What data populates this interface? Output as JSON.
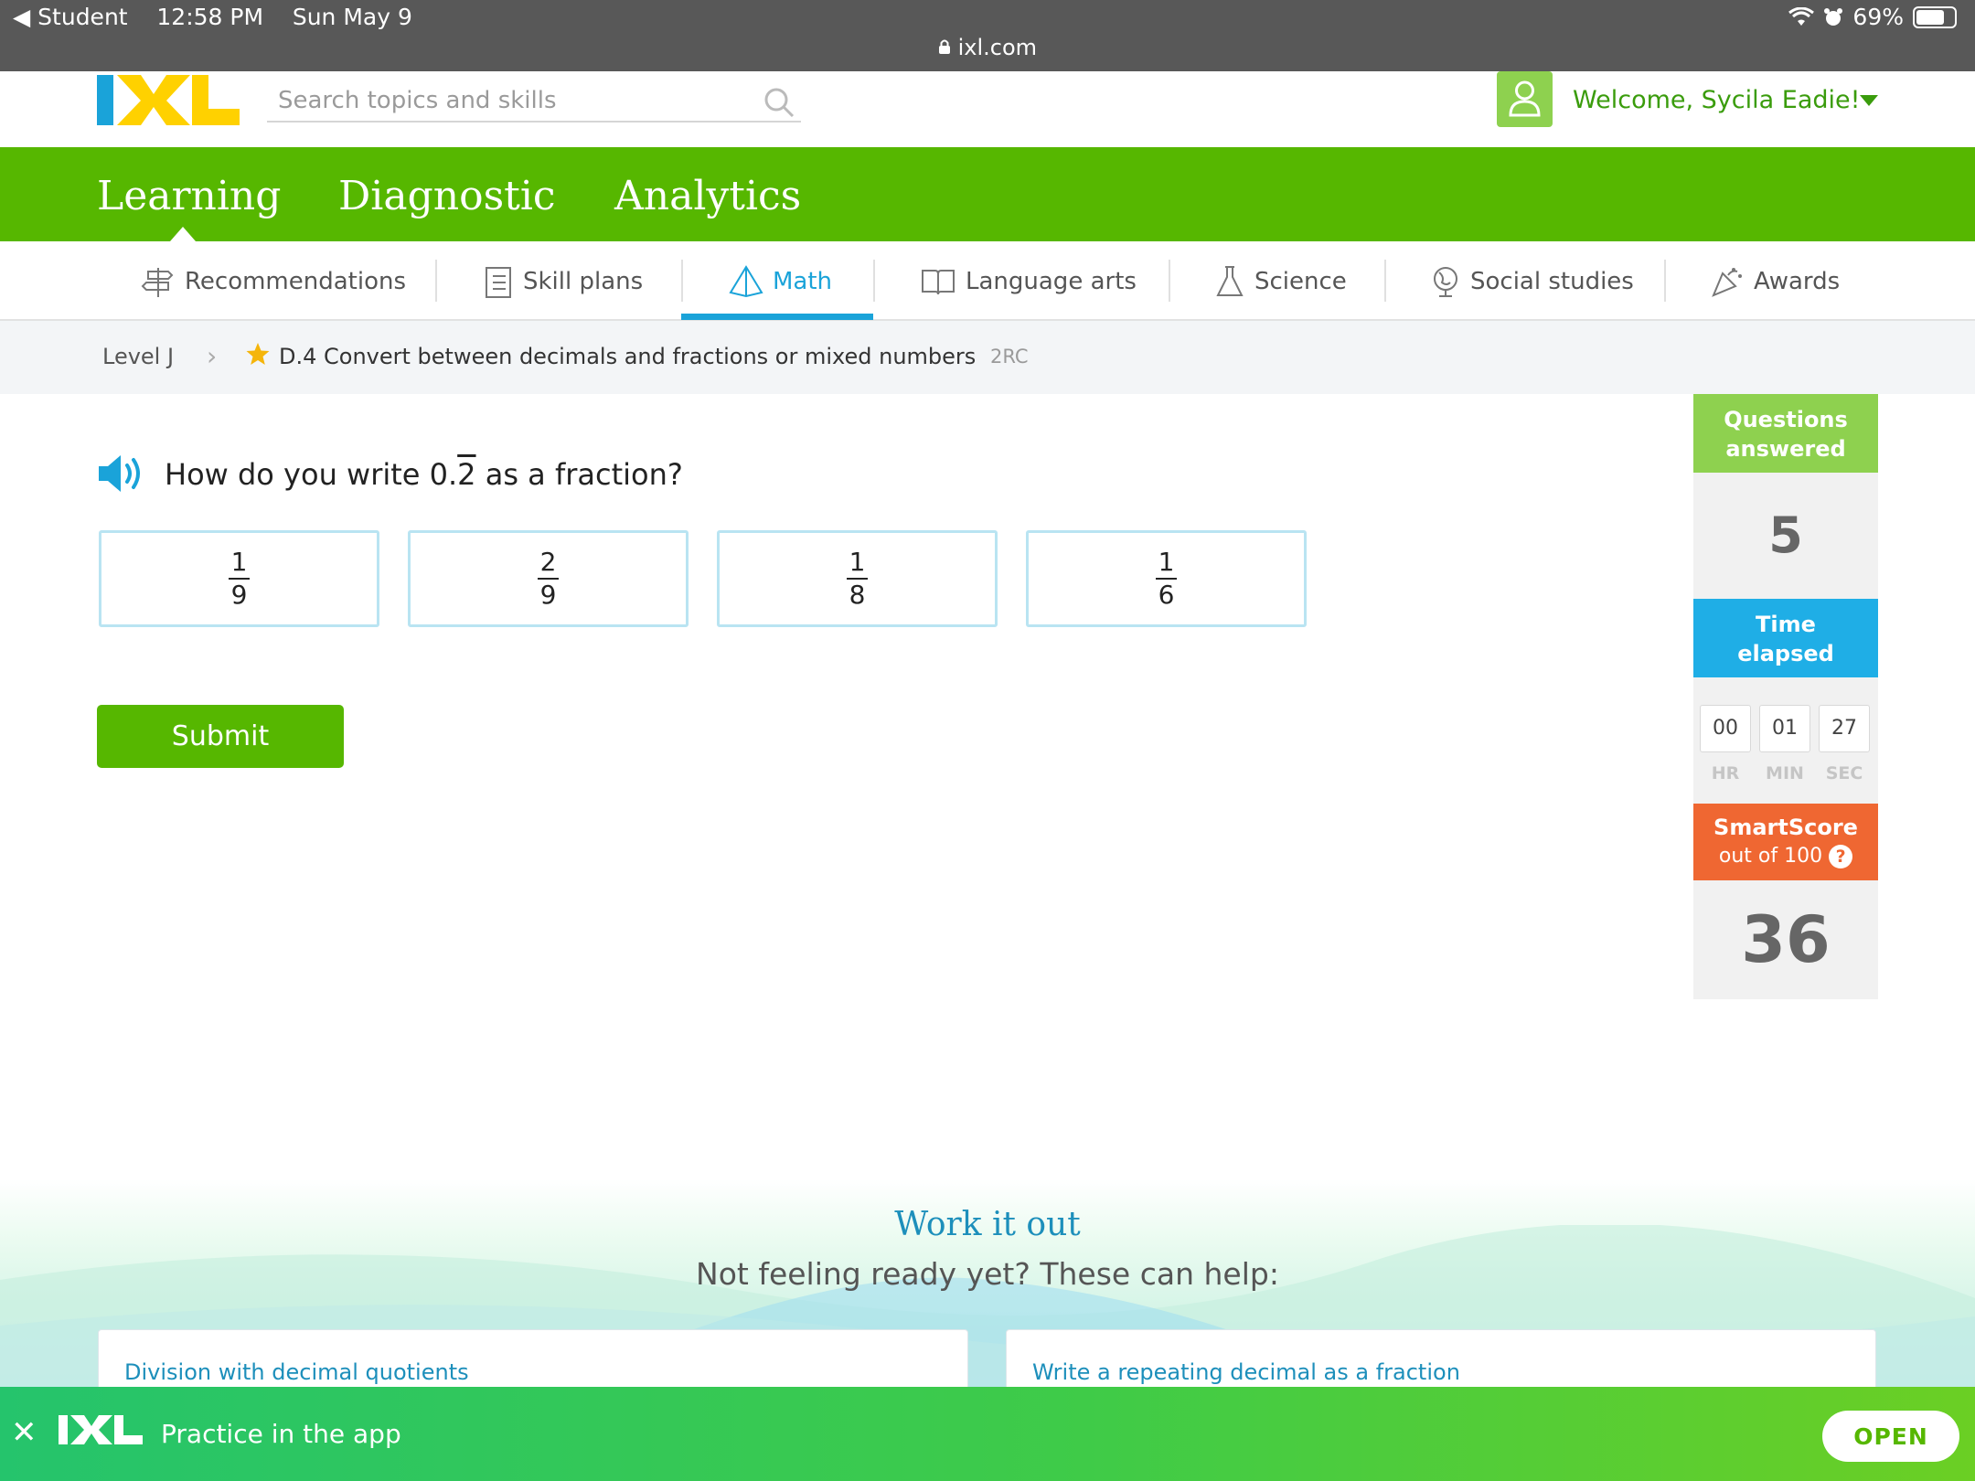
{
  "status_bar": {
    "back_app": "◀ Student",
    "time": "12:58 PM",
    "date": "Sun May 9",
    "battery": "69%",
    "url": "ixl.com"
  },
  "header": {
    "search_placeholder": "Search topics and skills",
    "welcome": "Welcome, Sycila Eadie!"
  },
  "main_nav": {
    "tabs": [
      {
        "label": "Learning",
        "active": true
      },
      {
        "label": "Diagnostic"
      },
      {
        "label": "Analytics"
      }
    ]
  },
  "subject_nav": {
    "tabs": [
      {
        "label": "Recommendations",
        "icon": "signpost-icon"
      },
      {
        "label": "Skill plans",
        "icon": "checklist-icon"
      },
      {
        "label": "Math",
        "icon": "pyramid-icon",
        "active": true
      },
      {
        "label": "Language arts",
        "icon": "book-icon"
      },
      {
        "label": "Science",
        "icon": "flask-icon"
      },
      {
        "label": "Social studies",
        "icon": "globe-icon"
      },
      {
        "label": "Awards",
        "icon": "party-popper-icon"
      }
    ]
  },
  "breadcrumb": {
    "level": "Level J",
    "skill": "D.4 Convert between decimals and fractions or mixed numbers",
    "code": "2RC"
  },
  "question": {
    "prefix": "How do you write 0.",
    "repeating_digit": "2",
    "suffix": " as a fraction?",
    "choices": [
      {
        "numerator": "1",
        "denominator": "9"
      },
      {
        "numerator": "2",
        "denominator": "9"
      },
      {
        "numerator": "1",
        "denominator": "8"
      },
      {
        "numerator": "1",
        "denominator": "6"
      }
    ],
    "submit_label": "Submit"
  },
  "sidebar": {
    "questions_answered_label_1": "Questions",
    "questions_answered_label_2": "answered",
    "questions_answered": "5",
    "time_elapsed_label_1": "Time",
    "time_elapsed_label_2": "elapsed",
    "time": {
      "hr": "00",
      "min": "01",
      "sec": "27"
    },
    "time_units": {
      "hr": "HR",
      "min": "MIN",
      "sec": "SEC"
    },
    "smartscore_label": "SmartScore",
    "smartscore_sub": "out of 100",
    "smartscore_help": "?",
    "smartscore": "36"
  },
  "work_it_out": {
    "title": "Work it out",
    "subtitle": "Not feeling ready yet? These can help:",
    "links": [
      "Division with decimal quotients",
      "Write a repeating decimal as a fraction"
    ]
  },
  "app_banner": {
    "text": "Practice in the app",
    "open_label": "OPEN"
  },
  "colors": {
    "brand_green": "#56b700",
    "accent_blue": "#1aa3d9",
    "smartscore_orange": "#ef6732"
  }
}
